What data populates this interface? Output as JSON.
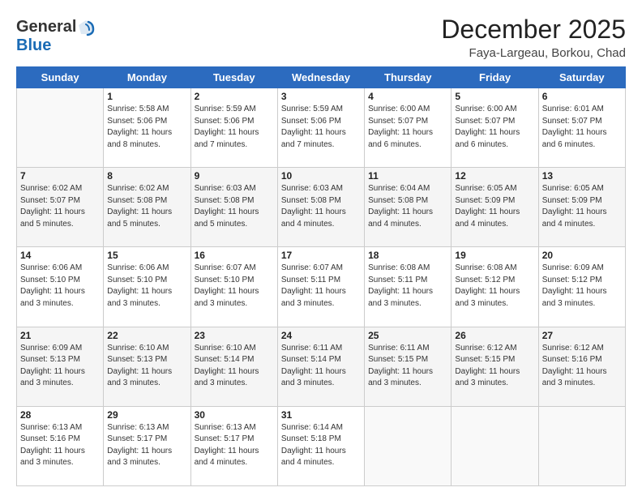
{
  "header": {
    "logo_line1": "General",
    "logo_line2": "Blue",
    "month_title": "December 2025",
    "location": "Faya-Largeau, Borkou, Chad"
  },
  "days_of_week": [
    "Sunday",
    "Monday",
    "Tuesday",
    "Wednesday",
    "Thursday",
    "Friday",
    "Saturday"
  ],
  "weeks": [
    [
      {
        "day": "",
        "sunrise": "",
        "sunset": "",
        "daylight": ""
      },
      {
        "day": "1",
        "sunrise": "Sunrise: 5:58 AM",
        "sunset": "Sunset: 5:06 PM",
        "daylight": "Daylight: 11 hours and 8 minutes."
      },
      {
        "day": "2",
        "sunrise": "Sunrise: 5:59 AM",
        "sunset": "Sunset: 5:06 PM",
        "daylight": "Daylight: 11 hours and 7 minutes."
      },
      {
        "day": "3",
        "sunrise": "Sunrise: 5:59 AM",
        "sunset": "Sunset: 5:06 PM",
        "daylight": "Daylight: 11 hours and 7 minutes."
      },
      {
        "day": "4",
        "sunrise": "Sunrise: 6:00 AM",
        "sunset": "Sunset: 5:07 PM",
        "daylight": "Daylight: 11 hours and 6 minutes."
      },
      {
        "day": "5",
        "sunrise": "Sunrise: 6:00 AM",
        "sunset": "Sunset: 5:07 PM",
        "daylight": "Daylight: 11 hours and 6 minutes."
      },
      {
        "day": "6",
        "sunrise": "Sunrise: 6:01 AM",
        "sunset": "Sunset: 5:07 PM",
        "daylight": "Daylight: 11 hours and 6 minutes."
      }
    ],
    [
      {
        "day": "7",
        "sunrise": "Sunrise: 6:02 AM",
        "sunset": "Sunset: 5:07 PM",
        "daylight": "Daylight: 11 hours and 5 minutes."
      },
      {
        "day": "8",
        "sunrise": "Sunrise: 6:02 AM",
        "sunset": "Sunset: 5:08 PM",
        "daylight": "Daylight: 11 hours and 5 minutes."
      },
      {
        "day": "9",
        "sunrise": "Sunrise: 6:03 AM",
        "sunset": "Sunset: 5:08 PM",
        "daylight": "Daylight: 11 hours and 5 minutes."
      },
      {
        "day": "10",
        "sunrise": "Sunrise: 6:03 AM",
        "sunset": "Sunset: 5:08 PM",
        "daylight": "Daylight: 11 hours and 4 minutes."
      },
      {
        "day": "11",
        "sunrise": "Sunrise: 6:04 AM",
        "sunset": "Sunset: 5:08 PM",
        "daylight": "Daylight: 11 hours and 4 minutes."
      },
      {
        "day": "12",
        "sunrise": "Sunrise: 6:05 AM",
        "sunset": "Sunset: 5:09 PM",
        "daylight": "Daylight: 11 hours and 4 minutes."
      },
      {
        "day": "13",
        "sunrise": "Sunrise: 6:05 AM",
        "sunset": "Sunset: 5:09 PM",
        "daylight": "Daylight: 11 hours and 4 minutes."
      }
    ],
    [
      {
        "day": "14",
        "sunrise": "Sunrise: 6:06 AM",
        "sunset": "Sunset: 5:10 PM",
        "daylight": "Daylight: 11 hours and 3 minutes."
      },
      {
        "day": "15",
        "sunrise": "Sunrise: 6:06 AM",
        "sunset": "Sunset: 5:10 PM",
        "daylight": "Daylight: 11 hours and 3 minutes."
      },
      {
        "day": "16",
        "sunrise": "Sunrise: 6:07 AM",
        "sunset": "Sunset: 5:10 PM",
        "daylight": "Daylight: 11 hours and 3 minutes."
      },
      {
        "day": "17",
        "sunrise": "Sunrise: 6:07 AM",
        "sunset": "Sunset: 5:11 PM",
        "daylight": "Daylight: 11 hours and 3 minutes."
      },
      {
        "day": "18",
        "sunrise": "Sunrise: 6:08 AM",
        "sunset": "Sunset: 5:11 PM",
        "daylight": "Daylight: 11 hours and 3 minutes."
      },
      {
        "day": "19",
        "sunrise": "Sunrise: 6:08 AM",
        "sunset": "Sunset: 5:12 PM",
        "daylight": "Daylight: 11 hours and 3 minutes."
      },
      {
        "day": "20",
        "sunrise": "Sunrise: 6:09 AM",
        "sunset": "Sunset: 5:12 PM",
        "daylight": "Daylight: 11 hours and 3 minutes."
      }
    ],
    [
      {
        "day": "21",
        "sunrise": "Sunrise: 6:09 AM",
        "sunset": "Sunset: 5:13 PM",
        "daylight": "Daylight: 11 hours and 3 minutes."
      },
      {
        "day": "22",
        "sunrise": "Sunrise: 6:10 AM",
        "sunset": "Sunset: 5:13 PM",
        "daylight": "Daylight: 11 hours and 3 minutes."
      },
      {
        "day": "23",
        "sunrise": "Sunrise: 6:10 AM",
        "sunset": "Sunset: 5:14 PM",
        "daylight": "Daylight: 11 hours and 3 minutes."
      },
      {
        "day": "24",
        "sunrise": "Sunrise: 6:11 AM",
        "sunset": "Sunset: 5:14 PM",
        "daylight": "Daylight: 11 hours and 3 minutes."
      },
      {
        "day": "25",
        "sunrise": "Sunrise: 6:11 AM",
        "sunset": "Sunset: 5:15 PM",
        "daylight": "Daylight: 11 hours and 3 minutes."
      },
      {
        "day": "26",
        "sunrise": "Sunrise: 6:12 AM",
        "sunset": "Sunset: 5:15 PM",
        "daylight": "Daylight: 11 hours and 3 minutes."
      },
      {
        "day": "27",
        "sunrise": "Sunrise: 6:12 AM",
        "sunset": "Sunset: 5:16 PM",
        "daylight": "Daylight: 11 hours and 3 minutes."
      }
    ],
    [
      {
        "day": "28",
        "sunrise": "Sunrise: 6:13 AM",
        "sunset": "Sunset: 5:16 PM",
        "daylight": "Daylight: 11 hours and 3 minutes."
      },
      {
        "day": "29",
        "sunrise": "Sunrise: 6:13 AM",
        "sunset": "Sunset: 5:17 PM",
        "daylight": "Daylight: 11 hours and 3 minutes."
      },
      {
        "day": "30",
        "sunrise": "Sunrise: 6:13 AM",
        "sunset": "Sunset: 5:17 PM",
        "daylight": "Daylight: 11 hours and 4 minutes."
      },
      {
        "day": "31",
        "sunrise": "Sunrise: 6:14 AM",
        "sunset": "Sunset: 5:18 PM",
        "daylight": "Daylight: 11 hours and 4 minutes."
      },
      {
        "day": "",
        "sunrise": "",
        "sunset": "",
        "daylight": ""
      },
      {
        "day": "",
        "sunrise": "",
        "sunset": "",
        "daylight": ""
      },
      {
        "day": "",
        "sunrise": "",
        "sunset": "",
        "daylight": ""
      }
    ]
  ]
}
